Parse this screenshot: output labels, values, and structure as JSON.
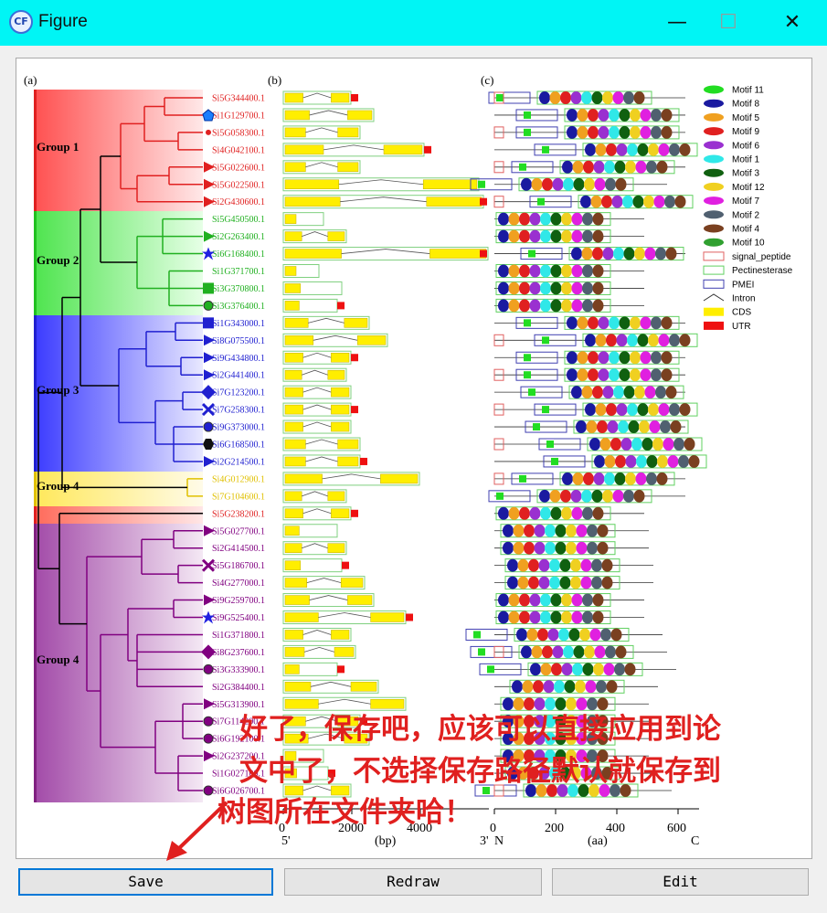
{
  "window": {
    "title": "Figure",
    "icon_label": "CF",
    "controls": {
      "minimize": "—",
      "maximize": "☐",
      "close": "✕"
    }
  },
  "panels": {
    "a": "(a)",
    "b": "(b)",
    "c": "(c)"
  },
  "groups": [
    "Group 1",
    "Group 2",
    "Group 3",
    "Group 4",
    "Group 4"
  ],
  "genes": [
    "Si5G344400.1",
    "Si1G129700.1",
    "Si5G058300.1",
    "Si4G042100.1",
    "Si5G022600.1",
    "Si5G022500.1",
    "Si2G430600.1",
    "Si5G450500.1",
    "Si2G263400.1",
    "Si6G168400.1",
    "Si1G371700.1",
    "Si3G370800.1",
    "Si3G376400.1",
    "Si1G343000.1",
    "Si8G075500.1",
    "Si9G434800.1",
    "Si2G441400.1",
    "Si7G123200.1",
    "Si7G258300.1",
    "Si9G373000.1",
    "Si6G168500.1",
    "Si2G214500.1",
    "Si4G012900.1",
    "Si7G104600.1",
    "Si5G238200.1",
    "Si5G027700.1",
    "Si2G414500.1",
    "Si5G186700.1",
    "Si4G277000.1",
    "Si9G259700.1",
    "Si9G525400.1",
    "Si1G371800.1",
    "Si8G237600.1",
    "Si3G333900.1",
    "Si2G384400.1",
    "Si5G313900.1",
    "Si7G114200.1",
    "Si6G192100.1",
    "Si2G237200.1",
    "Si1G027100.1",
    "Si6G026700.1"
  ],
  "gene_axis": {
    "ticks": [
      "0",
      "2000",
      "4000"
    ],
    "left_end": "5'",
    "right_end": "3'",
    "unit": "(bp)"
  },
  "protein_axis": {
    "ticks": [
      "0",
      "200",
      "400",
      "600"
    ],
    "left_end": "N",
    "right_end": "C",
    "unit": "(aa)"
  },
  "legend": [
    {
      "label": "Motif 11",
      "color": "#22dd22",
      "kind": "ellipse"
    },
    {
      "label": "Motif 8",
      "color": "#1a1aa0",
      "kind": "ellipse"
    },
    {
      "label": "Motif 5",
      "color": "#f0a020",
      "kind": "ellipse"
    },
    {
      "label": "Motif 9",
      "color": "#e02020",
      "kind": "ellipse"
    },
    {
      "label": "Motif 6",
      "color": "#9a30d0",
      "kind": "ellipse"
    },
    {
      "label": "Motif 1",
      "color": "#30e8e8",
      "kind": "ellipse"
    },
    {
      "label": "Motif 3",
      "color": "#106010",
      "kind": "ellipse"
    },
    {
      "label": "Motif 12",
      "color": "#f0d020",
      "kind": "ellipse"
    },
    {
      "label": "Motif 7",
      "color": "#e020e0",
      "kind": "ellipse"
    },
    {
      "label": "Motif 2",
      "color": "#506070",
      "kind": "ellipse"
    },
    {
      "label": "Motif 4",
      "color": "#7a4020",
      "kind": "ellipse"
    },
    {
      "label": "Motif 10",
      "color": "#30a030",
      "kind": "ellipse"
    },
    {
      "label": "signal_peptide",
      "color": "#e06060",
      "kind": "box"
    },
    {
      "label": "Pectinesterase",
      "color": "#60d060",
      "kind": "box"
    },
    {
      "label": "PMEI",
      "color": "#4040b0",
      "kind": "box"
    },
    {
      "label": "Intron",
      "color": "#333333",
      "kind": "line"
    },
    {
      "label": "CDS",
      "color": "#ffee00",
      "kind": "fill"
    },
    {
      "label": "UTR",
      "color": "#ee1111",
      "kind": "fill"
    }
  ],
  "overlay_text": [
    "好了，保存吧，应该可以直接应用到论",
    "文中了，不选择保存路径默认就保存到",
    "树图所在文件夹哈！"
  ],
  "buttons": {
    "save": "Save",
    "redraw": "Redraw",
    "edit": "Edit"
  }
}
